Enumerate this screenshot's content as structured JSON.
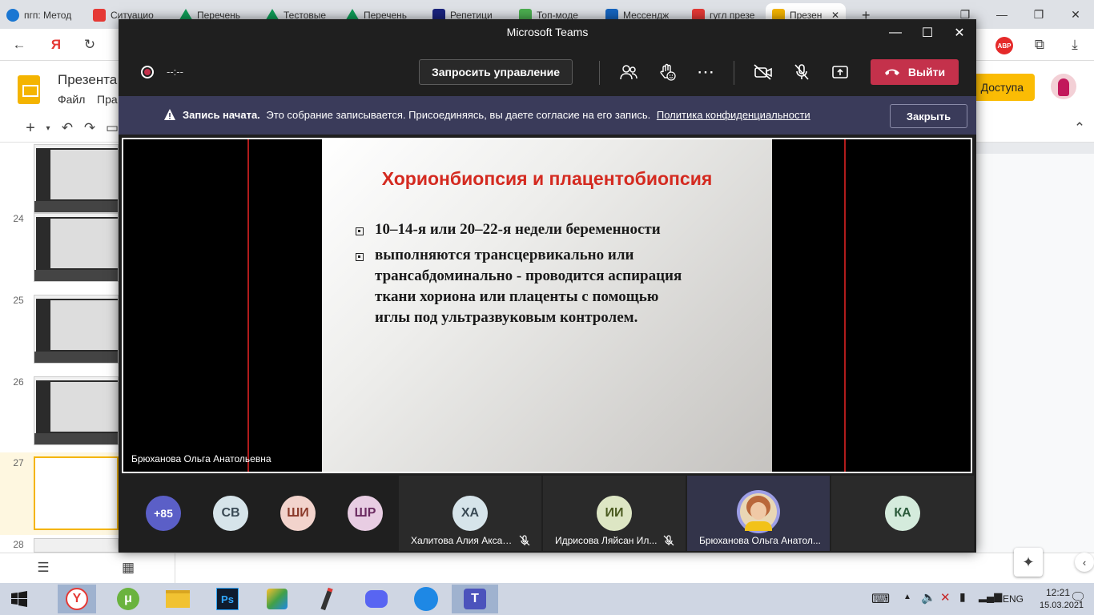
{
  "browser": {
    "tabs": [
      {
        "label": "пгп: Метод",
        "color": "#1976d2"
      },
      {
        "label": "Ситуацио",
        "color": "#e53935"
      },
      {
        "label": "Перечень",
        "color": "#0f9d58"
      },
      {
        "label": "Тестовые",
        "color": "#0f9d58"
      },
      {
        "label": "Перечень",
        "color": "#0f9d58"
      },
      {
        "label": "Репетици",
        "color": "#1a237e"
      },
      {
        "label": "Топ-моде",
        "color": "#4caf50"
      },
      {
        "label": "Мессендж",
        "color": "#1565c0"
      },
      {
        "label": "гугл презе",
        "color": "#e53935"
      },
      {
        "label": "Презен",
        "color": "#f4b400"
      }
    ],
    "abp_badge": "ABP"
  },
  "slides": {
    "doc_title": "Презента",
    "menu_file": "Файл",
    "menu_insert": "Пра",
    "share_label": "Доступа",
    "slide_numbers": [
      "24",
      "25",
      "26",
      "27",
      "28"
    ]
  },
  "teams": {
    "window_title": "Microsoft Teams",
    "timer": "--:--",
    "request_control": "Запросить управление",
    "leave_label": "Выйти",
    "banner": {
      "bold": "Запись начата.",
      "text": "Это собрание записывается. Присоединяясь, вы даете согласие на его запись.",
      "link": "Политика конфиденциальности",
      "close_label": "Закрыть"
    },
    "presentation": {
      "title": "Хорионбиопсия и плацентобиопсия",
      "bullet1": "10–14-я или 20–22-я недели беременности",
      "bullet2_lines": [
        "выполняются трансцервикально или",
        "трансабдоминально - проводится аспирация",
        "ткани хориона или плаценты с помощью",
        "иглы под ультразвуковым контролем."
      ]
    },
    "presenter": "Брюханова Ольга Анатольевна",
    "gallery": {
      "more_count": "+85",
      "small_avatars": [
        {
          "initials": "СВ",
          "bg": "#d6e4ea",
          "fg": "#3a4a55"
        },
        {
          "initials": "ШИ",
          "bg": "#f2d3cc",
          "fg": "#8a3a2a"
        },
        {
          "initials": "ШР",
          "bg": "#e8cde3",
          "fg": "#6a2a60"
        }
      ],
      "tiles": [
        {
          "initials": "ХА",
          "name": "Халитова Алия Аксан...",
          "bg": "#d6e4ea",
          "fg": "#3a4a55"
        },
        {
          "initials": "ИИ",
          "name": "Идрисова Ляйсан Ил...",
          "bg": "#dde6c4",
          "fg": "#4a5a20"
        },
        {
          "initials": "",
          "name": "Брюханова Ольга Анатол..."
        },
        {
          "initials": "КА",
          "name": "",
          "bg": "#d4ebdc",
          "fg": "#2a5a3a"
        }
      ]
    }
  },
  "taskbar": {
    "lang": "ENG",
    "time": "12:21",
    "date": "15.03.2021"
  }
}
